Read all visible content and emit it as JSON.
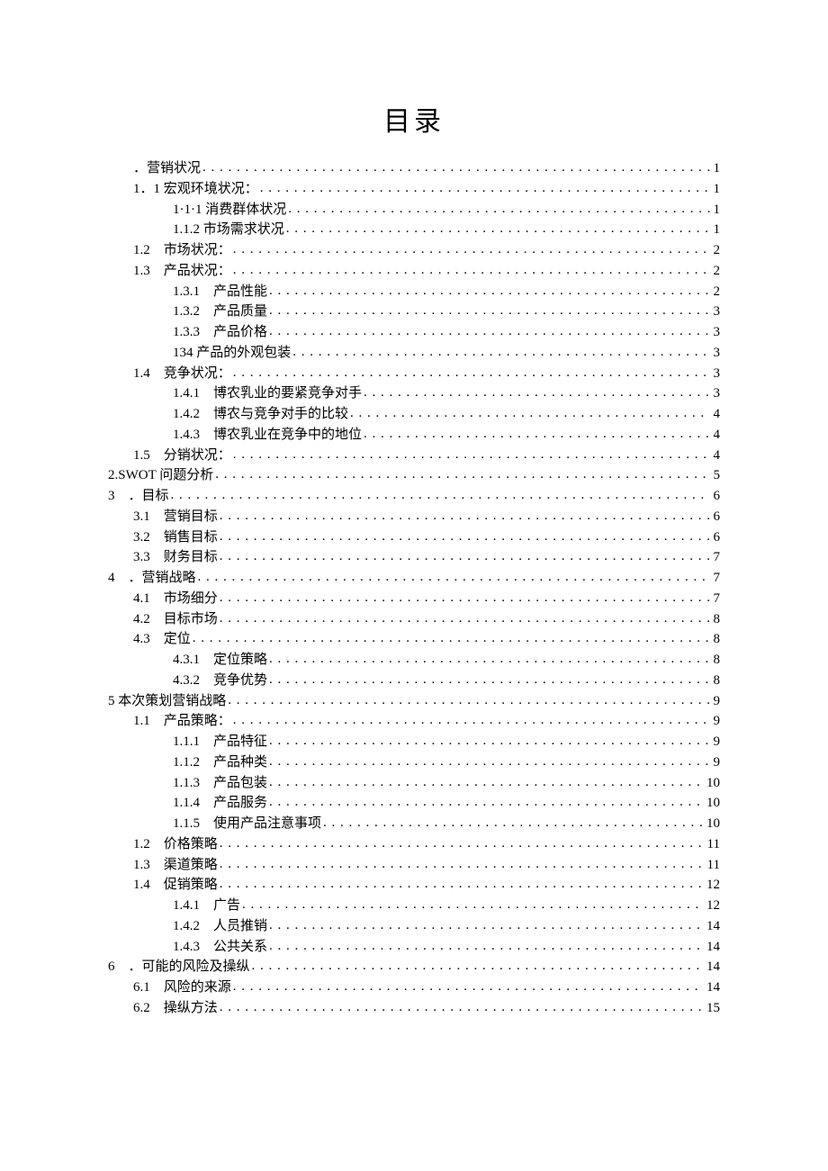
{
  "title": "目录",
  "toc": [
    {
      "indent": 1,
      "label": "．营销状况",
      "page": "1"
    },
    {
      "indent": 1,
      "label": "1．1 宏观环境状况：",
      "page": "1"
    },
    {
      "indent": 2,
      "label": "1·1·1 消费群体状况",
      "page": "1"
    },
    {
      "indent": 2,
      "label": "1.1.2 市场需求状况",
      "page": "1"
    },
    {
      "indent": 1,
      "label": "1.2　市场状况：",
      "page": "2"
    },
    {
      "indent": 1,
      "label": "1.3　产品状况：",
      "page": "2"
    },
    {
      "indent": 2,
      "label": "1.3.1　产品性能",
      "page": "2"
    },
    {
      "indent": 2,
      "label": "1.3.2　产品质量",
      "page": "3"
    },
    {
      "indent": 2,
      "label": "1.3.3　产品价格",
      "page": "3"
    },
    {
      "indent": 2,
      "label": "134 产品的外观包装",
      "page": "3"
    },
    {
      "indent": 1,
      "label": "1.4　竞争状况：",
      "page": "3"
    },
    {
      "indent": 2,
      "label": "1.4.1　博农乳业的要紧竞争对手",
      "page": "3"
    },
    {
      "indent": 2,
      "label": "1.4.2　博农与竞争对手的比较",
      "page": "4"
    },
    {
      "indent": 2,
      "label": "1.4.3　博农乳业在竞争中的地位",
      "page": "4"
    },
    {
      "indent": 1,
      "label": "1.5　分销状况：",
      "page": "4"
    },
    {
      "indent": 0,
      "label": "2.SWOT 问题分析",
      "page": "5"
    },
    {
      "indent": 0,
      "label": "3　．目标",
      "page": "6"
    },
    {
      "indent": 1,
      "label": "3.1　营销目标",
      "page": "6"
    },
    {
      "indent": 1,
      "label": "3.2　销售目标",
      "page": "6"
    },
    {
      "indent": 1,
      "label": "3.3　财务目标",
      "page": "7"
    },
    {
      "indent": 0,
      "label": "4　．营销战略",
      "page": "7"
    },
    {
      "indent": 1,
      "label": "4.1　市场细分",
      "page": "7"
    },
    {
      "indent": 1,
      "label": "4.2　目标市场",
      "page": "8"
    },
    {
      "indent": 1,
      "label": "4.3　定位",
      "page": "8"
    },
    {
      "indent": 2,
      "label": "4.3.1　定位策略",
      "page": "8"
    },
    {
      "indent": 2,
      "label": "4.3.2　竞争优势",
      "page": "8"
    },
    {
      "indent": 0,
      "label": "5 本次策划营销战略",
      "page": "9"
    },
    {
      "indent": 1,
      "label": "1.1　产品策略：",
      "page": "9"
    },
    {
      "indent": 2,
      "label": "1.1.1　产品特征",
      "page": "9"
    },
    {
      "indent": 2,
      "label": "1.1.2　产品种类",
      "page": "9"
    },
    {
      "indent": 2,
      "label": "1.1.3　产品包装",
      "page": "10"
    },
    {
      "indent": 2,
      "label": "1.1.4　产品服务",
      "page": "10"
    },
    {
      "indent": 2,
      "label": "1.1.5　使用产品注意事项",
      "page": "10"
    },
    {
      "indent": 1,
      "label": "1.2　价格策略",
      "page": "11"
    },
    {
      "indent": 1,
      "label": "1.3　渠道策略",
      "page": "11"
    },
    {
      "indent": 1,
      "label": "1.4　促销策略",
      "page": "12"
    },
    {
      "indent": 2,
      "label": "1.4.1　广告",
      "page": "12"
    },
    {
      "indent": 2,
      "label": "1.4.2　人员推销",
      "page": "14"
    },
    {
      "indent": 2,
      "label": "1.4.3　公共关系",
      "page": "14"
    },
    {
      "indent": 0,
      "label": "6　．可能的风险及操纵",
      "page": "14"
    },
    {
      "indent": 1,
      "label": "6.1　风险的来源",
      "page": "14"
    },
    {
      "indent": 1,
      "label": "6.2　操纵方法",
      "page": "15"
    }
  ]
}
